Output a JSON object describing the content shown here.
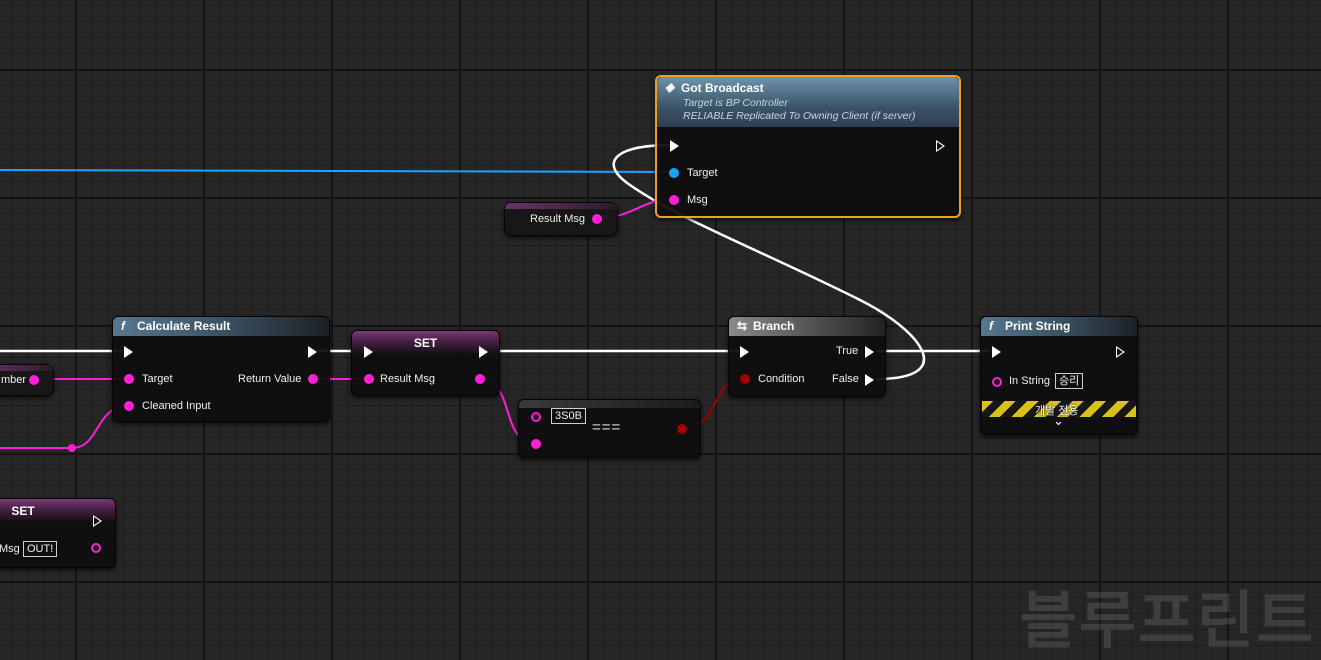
{
  "colors": {
    "string_pin": "#ff1fd6",
    "object_pin": "#1fa2ff",
    "bool_pin": "#a00000",
    "exec_pin": "#ffffff",
    "selected_outline": "#f0a020"
  },
  "nodes": {
    "got_broadcast": {
      "title": "Got Broadcast",
      "subtitle1": "Target is BP Controller",
      "subtitle2": "RELIABLE Replicated To Owning Client (if server)",
      "pin_target": "Target",
      "pin_msg": "Msg",
      "icon": "event-icon"
    },
    "result_msg_getter": {
      "label": "Result Msg"
    },
    "calculate_result": {
      "title": "Calculate Result",
      "icon_glyph": "f",
      "pin_target": "Target",
      "pin_cleaned_input": "Cleaned Input",
      "pin_return_value": "Return Value"
    },
    "set_result": {
      "title": "SET",
      "pin_result_msg": "Result Msg"
    },
    "equals": {
      "value": "3S0B",
      "operator": "==="
    },
    "branch": {
      "title": "Branch",
      "pin_condition": "Condition",
      "pin_true": "True",
      "pin_false": "False"
    },
    "print_string": {
      "title": "Print String",
      "icon_glyph": "f",
      "pin_in_string": "In String",
      "in_string_value": "승리",
      "dev_only_label": "개발 전용",
      "expand_glyph": "⌄"
    },
    "set_lower": {
      "title": "SET",
      "pin_label": "Msg",
      "value": "OUT!"
    },
    "partial_left": {
      "label": "mber"
    }
  },
  "watermark": "블루프린트"
}
